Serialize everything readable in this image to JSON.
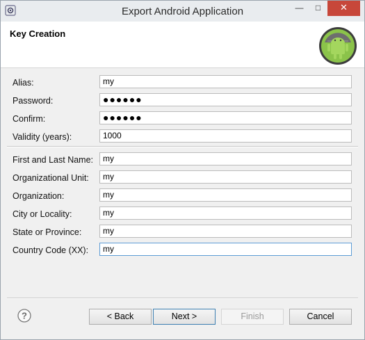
{
  "window": {
    "title": "Export Android Application",
    "minimize": "—",
    "maximize": "□",
    "close": "✕"
  },
  "header": {
    "title": "Key Creation",
    "logo_icon": "android-logo-icon"
  },
  "form": {
    "key_fields": [
      {
        "label": "Alias:",
        "value": "my",
        "type": "text"
      },
      {
        "label": "Password:",
        "value": "●●●●●●",
        "type": "password"
      },
      {
        "label": "Confirm:",
        "value": "●●●●●●",
        "type": "password"
      },
      {
        "label": "Validity (years):",
        "value": "1000",
        "type": "text"
      }
    ],
    "owner_fields": [
      {
        "label": "First and Last Name:",
        "value": "my"
      },
      {
        "label": "Organizational Unit:",
        "value": "my"
      },
      {
        "label": "Organization:",
        "value": "my"
      },
      {
        "label": "City or Locality:",
        "value": "my"
      },
      {
        "label": "State or Province:",
        "value": "my"
      },
      {
        "label": "Country Code (XX):",
        "value": "my",
        "focused": true
      }
    ]
  },
  "footer": {
    "help_icon": "help-icon",
    "back_label": "< Back",
    "next_label": "Next >",
    "finish_label": "Finish",
    "cancel_label": "Cancel"
  },
  "colors": {
    "close_button": "#c7473a",
    "focus_border": "#5b9bd5",
    "android_green": "#8bc34a"
  }
}
